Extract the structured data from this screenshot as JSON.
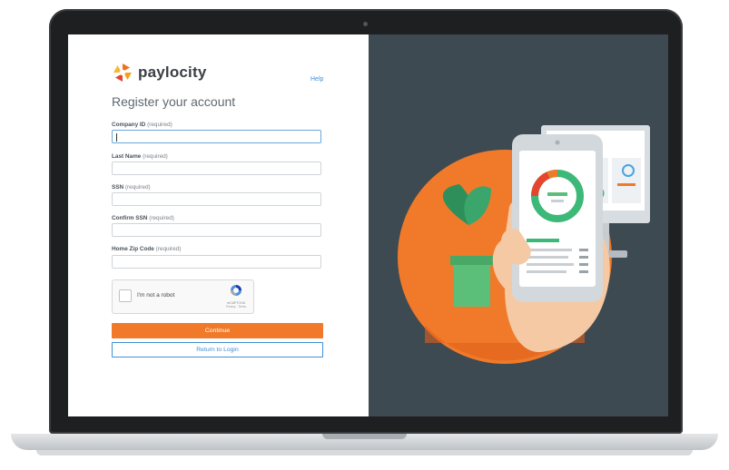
{
  "brand": {
    "name": "paylocity",
    "logo_colors": [
      "#f26f21",
      "#f9a01b",
      "#e5452e",
      "#f7b733"
    ]
  },
  "header": {
    "help_label": "Help"
  },
  "form": {
    "title": "Register your account",
    "fields": [
      {
        "label": "Company ID",
        "qualifier": "(required)",
        "value": "",
        "focused": true
      },
      {
        "label": "Last Name",
        "qualifier": "(required)",
        "value": ""
      },
      {
        "label": "SSN",
        "qualifier": "(required)",
        "value": ""
      },
      {
        "label": "Confirm SSN",
        "qualifier": "(required)",
        "value": ""
      },
      {
        "label": "Home Zip Code",
        "qualifier": "(required)",
        "value": ""
      }
    ],
    "captcha": {
      "label": "I'm not a robot",
      "brand": "reCAPTCHA",
      "links": "Privacy - Terms",
      "checked": false
    },
    "continue_label": "Continue",
    "return_label": "Return to Login"
  },
  "colors": {
    "accent": "#f07a2a",
    "link": "#3f8fd3",
    "panel_bg": "#3e4a51"
  }
}
